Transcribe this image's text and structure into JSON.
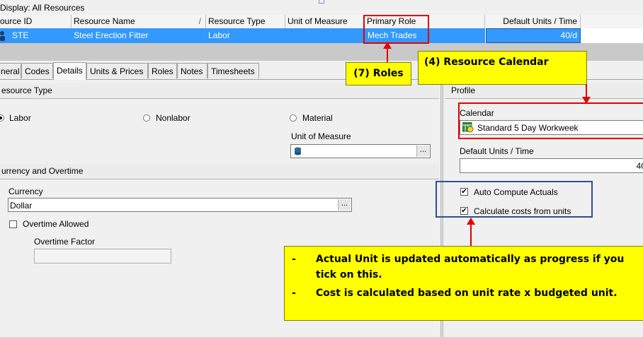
{
  "window": {
    "title": "Display: All Resources"
  },
  "grid": {
    "columns": [
      "ource ID",
      "Resource Name",
      "Resource Type",
      "Unit of Measure",
      "Primary Role",
      "Default Units / Time"
    ],
    "row": {
      "id": "STE",
      "name": "Steel Erection Fitter",
      "type": "Labor",
      "uom": "",
      "role": "Mech Trades",
      "default_units": "40/d"
    }
  },
  "tabs": [
    "neral",
    "Codes",
    "Details",
    "Units & Prices",
    "Roles",
    "Notes",
    "Timesheets"
  ],
  "active_tab": "Details",
  "resource_type": {
    "heading": "esource Type",
    "options": [
      "Labor",
      "Nonlabor",
      "Material"
    ],
    "selected": "Labor",
    "uom_label": "Unit of Measure",
    "uom_value": ""
  },
  "currency_overtime": {
    "heading": "urrency and Overtime",
    "currency_label": "Currency",
    "currency_value": "Dollar",
    "overtime_allowed_label": "Overtime Allowed",
    "overtime_allowed": false,
    "overtime_factor_label": "Overtime Factor",
    "overtime_factor_value": ""
  },
  "profile": {
    "heading": "Profile",
    "calendar_label": "Calendar",
    "calendar_value": "Standard 5 Day Workweek",
    "default_units_label": "Default Units / Time",
    "default_units_value": "40",
    "auto_compute_label": "Auto Compute Actuals",
    "auto_compute": true,
    "calc_costs_label": "Calculate costs from units",
    "calc_costs": true
  },
  "annotations": {
    "roles": "(7) Roles",
    "calendar": "(4) Resource Calendar",
    "note_lines": [
      "Actual Unit is updated automatically as progress if you tick on this.",
      "Cost is calculated based on unit rate x budgeted unit."
    ],
    "note_bullet": "-"
  },
  "colors": {
    "selection": "#3399ff",
    "callout_fill": "#ffff00",
    "highlight_border": "#e00000",
    "group_border": "#2f4f8f"
  },
  "icons": {
    "row": "resource-person-icon",
    "uom": "measure-cylinder-icon",
    "calendar": "calendar-icon"
  }
}
